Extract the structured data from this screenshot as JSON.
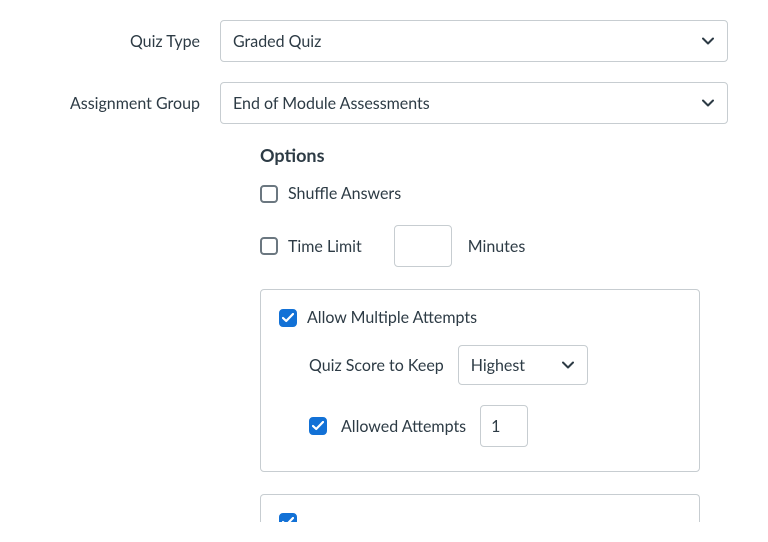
{
  "quizType": {
    "label": "Quiz Type",
    "value": "Graded Quiz"
  },
  "assignmentGroup": {
    "label": "Assignment Group",
    "value": "End of Module Assessments"
  },
  "options": {
    "heading": "Options",
    "shuffle": {
      "label": "Shuffle Answers",
      "checked": false
    },
    "timeLimit": {
      "label": "Time Limit",
      "checked": false,
      "value": "",
      "suffix": "Minutes"
    },
    "multipleAttempts": {
      "label": "Allow Multiple Attempts",
      "checked": true,
      "scoreToKeep": {
        "label": "Quiz Score to Keep",
        "value": "Highest"
      },
      "allowedAttempts": {
        "label": "Allowed Attempts",
        "checked": true,
        "value": "1"
      }
    }
  }
}
